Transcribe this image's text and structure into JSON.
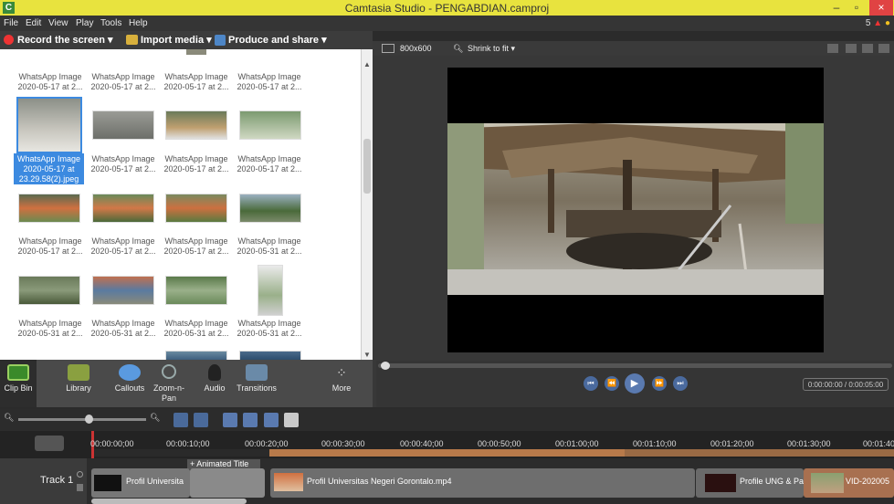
{
  "window": {
    "title": "Camtasia Studio - PENGABDIAN.camproj",
    "app_icon": "C",
    "min": "–",
    "max": "▫",
    "close": "×"
  },
  "menu": {
    "items": [
      "File",
      "Edit",
      "View",
      "Play",
      "Tools",
      "Help"
    ],
    "right_count": "5"
  },
  "toolbar": {
    "record": "Record the screen ▾",
    "import": "Import media ▾",
    "produce": "Produce and share ▾"
  },
  "clip_bin": {
    "selected_caption": "WhatsApp Image 2020-05-17 at 23.29.58(2).jpeg",
    "items": [
      {
        "l1": "WhatsApp Image",
        "l2": "2020-05-17 at 2..."
      },
      {
        "l1": "WhatsApp Image",
        "l2": "2020-05-17 at 2..."
      },
      {
        "l1": "WhatsApp Image",
        "l2": "2020-05-17 at 2..."
      },
      {
        "l1": "WhatsApp Image",
        "l2": "2020-05-17 at 2..."
      },
      {
        "l1": "WhatsApp Image",
        "l2": "2020-05-17 at 2..."
      },
      {
        "l1": "WhatsApp Image",
        "l2": "2020-05-17 at 2..."
      },
      {
        "l1": "WhatsApp Image",
        "l2": "2020-05-17 at 2..."
      },
      {
        "l1": "WhatsApp Image",
        "l2": "2020-05-17 at 2..."
      },
      {
        "l1": "WhatsApp Image",
        "l2": "2020-05-17 at 2..."
      },
      {
        "l1": "WhatsApp Image",
        "l2": "2020-05-17 at 2..."
      },
      {
        "l1": "WhatsApp Image",
        "l2": "2020-05-31 at 2..."
      },
      {
        "l1": "WhatsApp Image",
        "l2": "2020-05-31 at 2..."
      },
      {
        "l1": "WhatsApp Image",
        "l2": "2020-05-31 at 2..."
      },
      {
        "l1": "WhatsApp Image",
        "l2": "2020-05-31 at 2..."
      },
      {
        "l1": "WhatsApp Image",
        "l2": "2020-05-31 at 2..."
      }
    ]
  },
  "tabs": [
    "Clip Bin",
    "Library",
    "Callouts",
    "Zoom-n-Pan",
    "Audio",
    "Transitions",
    "More"
  ],
  "preview": {
    "size": "800x600",
    "zoom": "Shrink to fit ▾",
    "time": "0:00:00:00 / 0:00:05:00"
  },
  "timeline": {
    "ruler": [
      "00:00:00;00",
      "00:00:10;00",
      "00:00:20;00",
      "00:00:30;00",
      "00:00:40;00",
      "00:00:50;00",
      "00:01:00;00",
      "00:01:10;00",
      "00:01:20;00",
      "00:01:30;00",
      "00:01:40"
    ],
    "track": "Track 1",
    "animated_title": "+ Animated Title",
    "clips": [
      "Profil Universita",
      "Profil Universitas Negeri Gorontalo.mp4",
      "Profile UNG & Pa",
      "VID-202005"
    ]
  }
}
